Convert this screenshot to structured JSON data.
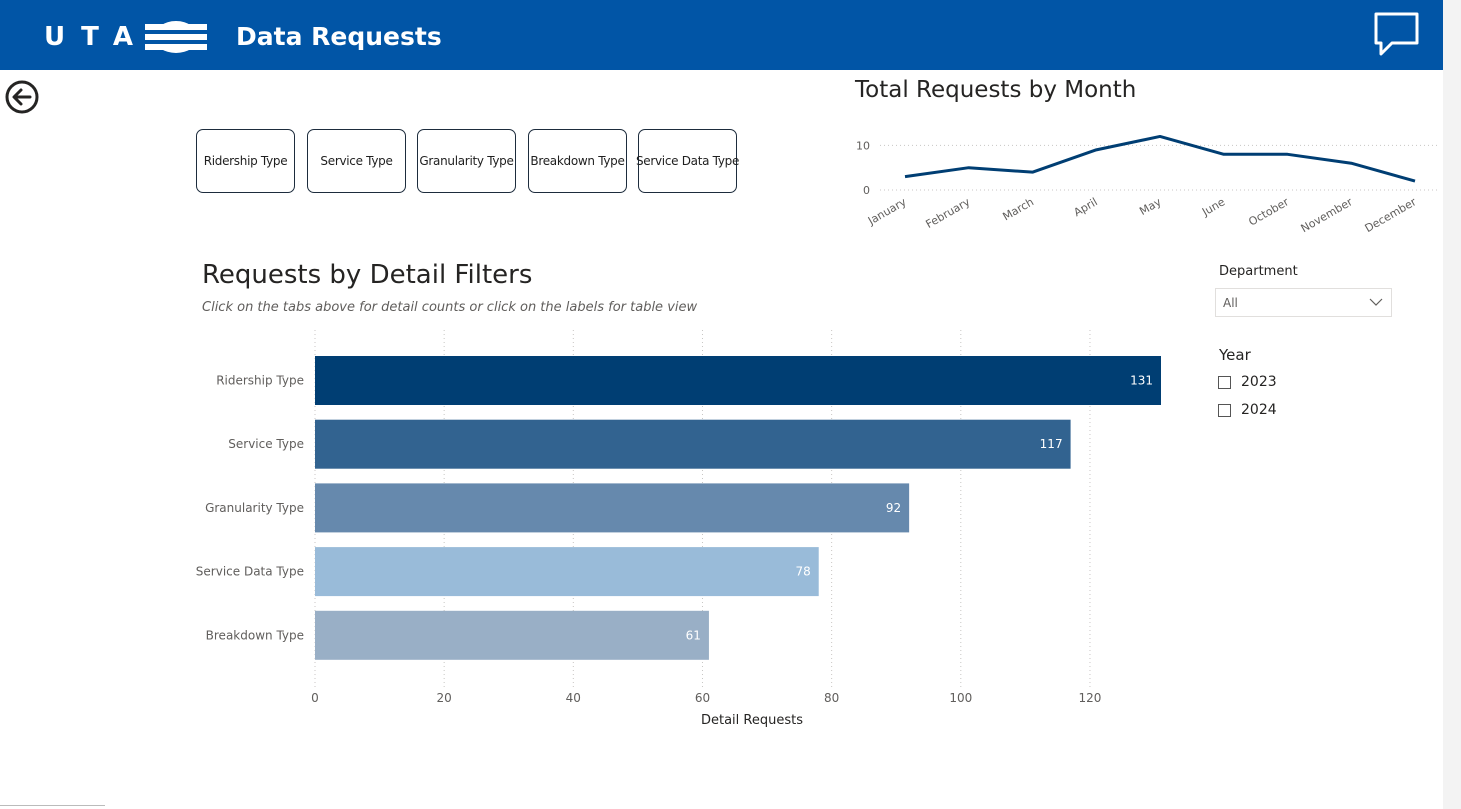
{
  "header": {
    "logo_text": "UTA",
    "title": "Data Requests",
    "background_color": "#0155a6"
  },
  "icons": {
    "back": "back-arrow-icon",
    "feedback": "speech-bubble-icon",
    "dropdown": "chevron-down-icon"
  },
  "tabs": [
    {
      "label": "Ridership Type"
    },
    {
      "label": "Service Type"
    },
    {
      "label": "Granularity Type"
    },
    {
      "label": "Breakdown Type"
    },
    {
      "label": "Service Data Type"
    }
  ],
  "line_chart": {
    "title": "Total Requests by Month"
  },
  "bar_chart": {
    "title": "Requests by Detail Filters",
    "subtitle": "Click on the tabs above for detail counts or click on the labels for table view"
  },
  "filters": {
    "department": {
      "label": "Department",
      "value": "All"
    },
    "year": {
      "label": "Year",
      "options": [
        {
          "label": "2023",
          "checked": false
        },
        {
          "label": "2024",
          "checked": false
        }
      ]
    }
  },
  "chart_data": [
    {
      "type": "line",
      "title": "Total Requests by Month",
      "x": [
        "January",
        "February",
        "March",
        "April",
        "May",
        "June",
        "October",
        "November",
        "December"
      ],
      "series": [
        {
          "values": [
            3,
            5,
            4,
            9,
            12,
            8,
            8,
            6,
            2
          ]
        }
      ],
      "y_ticks": [
        0,
        10
      ],
      "ylim": [
        0,
        13
      ],
      "grid": true,
      "line_color": "#003e73"
    },
    {
      "type": "bar",
      "orientation": "horizontal",
      "title": "Requests by Detail Filters",
      "categories": [
        "Ridership Type",
        "Service Type",
        "Granularity Type",
        "Service Data Type",
        "Breakdown Type"
      ],
      "values": [
        131,
        117,
        92,
        78,
        61
      ],
      "colors": [
        "#003e73",
        "#326390",
        "#6689ad",
        "#99bbd9",
        "#99afc6"
      ],
      "xlabel": "Detail Requests",
      "x_ticks": [
        0,
        20,
        40,
        60,
        80,
        100,
        120
      ],
      "xlim": [
        0,
        131
      ],
      "grid": true,
      "data_labels": true
    }
  ]
}
